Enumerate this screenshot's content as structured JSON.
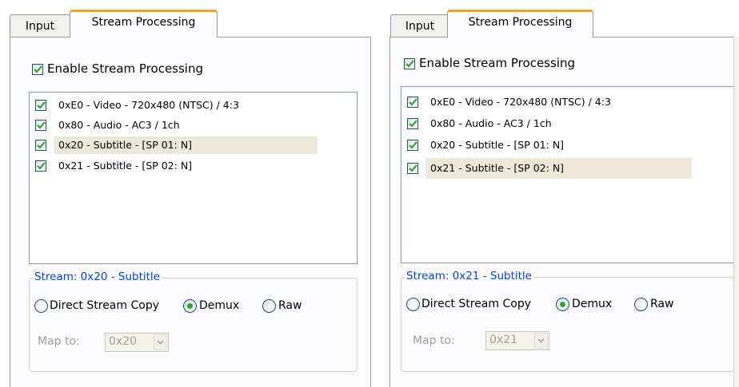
{
  "panels": [
    {
      "tabs": [
        {
          "label": "Input"
        },
        {
          "label": "Stream Processing"
        }
      ],
      "enable": {
        "label": "Enable Stream Processing",
        "checked": true
      },
      "streams": [
        {
          "label": "0xE0 - Video - 720x480 (NTSC) / 4:3",
          "checked": true,
          "selected": false
        },
        {
          "label": "0x80 - Audio - AC3 / 1ch",
          "checked": true,
          "selected": false
        },
        {
          "label": "0x20 - Subtitle - [SP 01: N]",
          "checked": true,
          "selected": true
        },
        {
          "label": "0x21 - Subtitle - [SP 02: N]",
          "checked": true,
          "selected": false
        }
      ],
      "group": {
        "title": "Stream: 0x20 - Subtitle",
        "options": [
          {
            "label": "Direct Stream Copy",
            "selected": false
          },
          {
            "label": "Demux",
            "selected": true
          },
          {
            "label": "Raw",
            "selected": false
          }
        ],
        "map_label": "Map to:",
        "map_value": "0x20"
      }
    },
    {
      "tabs": [
        {
          "label": "Input"
        },
        {
          "label": "Stream Processing"
        }
      ],
      "enable": {
        "label": "Enable Stream Processing",
        "checked": true
      },
      "streams": [
        {
          "label": "0xE0 - Video - 720x480 (NTSC) / 4:3",
          "checked": true,
          "selected": false
        },
        {
          "label": "0x80 - Audio - AC3 / 1ch",
          "checked": true,
          "selected": false
        },
        {
          "label": "0x20 - Subtitle - [SP 01: N]",
          "checked": true,
          "selected": false
        },
        {
          "label": "0x21 - Subtitle - [SP 02: N]",
          "checked": true,
          "selected": true
        }
      ],
      "group": {
        "title": "Stream: 0x21 - Subtitle",
        "options": [
          {
            "label": "Direct Stream Copy",
            "selected": false
          },
          {
            "label": "Demux",
            "selected": true
          },
          {
            "label": "Raw",
            "selected": false
          }
        ],
        "map_label": "Map to:",
        "map_value": "0x21"
      }
    }
  ],
  "colors": {
    "accent_tab": "#f6a21a",
    "check": "#2ea636",
    "group_title": "#0046d5",
    "selection": "#ece9d8"
  }
}
